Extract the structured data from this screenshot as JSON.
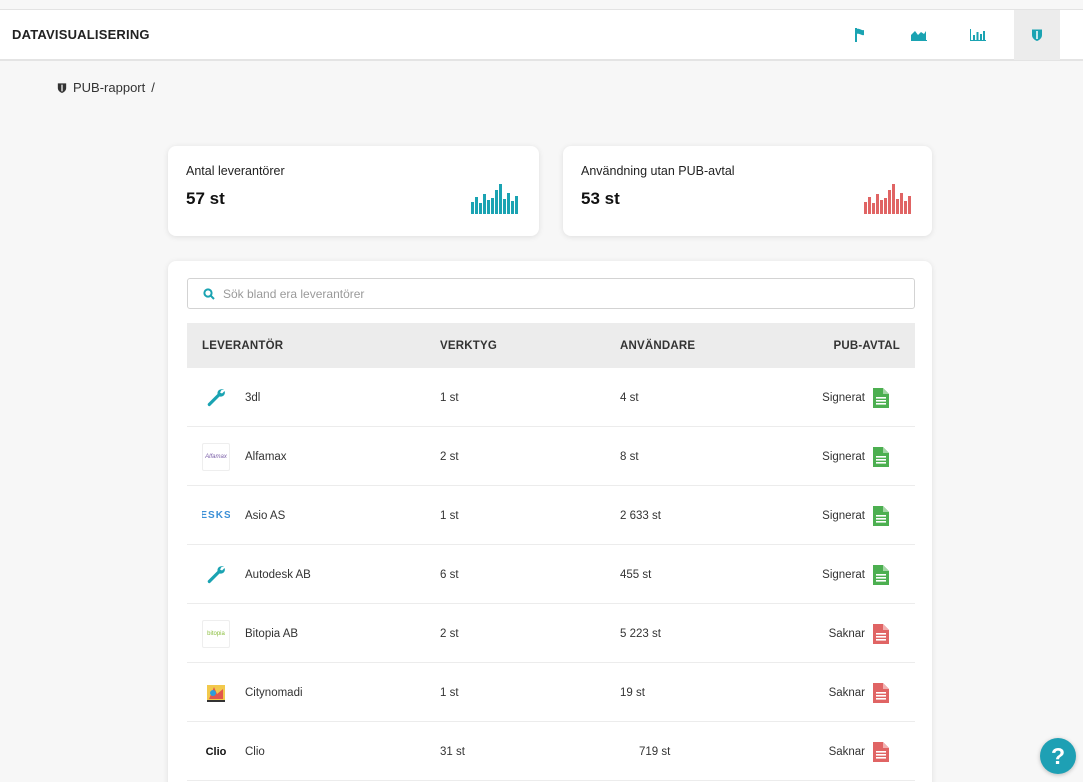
{
  "header": {
    "title": "DATAVISUALISERING",
    "nav": [
      {
        "icon": "flag-icon",
        "active": false
      },
      {
        "icon": "area-chart-icon",
        "active": false
      },
      {
        "icon": "bar-chart-icon",
        "active": false
      },
      {
        "icon": "shield-icon",
        "active": true
      }
    ]
  },
  "breadcrumb": {
    "label": "PUB-rapport",
    "separator": "/"
  },
  "stats": [
    {
      "label": "Antal leverantörer",
      "value": "57 st",
      "color": "#1aa3b2"
    },
    {
      "label": "Användning utan PUB-avtal",
      "value": "53 st",
      "color": "#e06464"
    }
  ],
  "search": {
    "placeholder": "Sök bland era leverantörer",
    "value": ""
  },
  "table": {
    "columns": [
      "LEVERANTÖR",
      "VERKTYG",
      "ANVÄNDARE",
      "PUB-AVTAL"
    ],
    "rows": [
      {
        "name": "3dl",
        "logo": "wrench-icon",
        "tools": "1 st",
        "users": "4 st",
        "status": "Signerat",
        "signed": true
      },
      {
        "name": "Alfamax",
        "logo": "alfamax-logo",
        "logo_text": "Alfamax",
        "tools": "2 st",
        "users": "8 st",
        "status": "Signerat",
        "signed": true
      },
      {
        "name": "Asio AS",
        "logo": "asio-logo",
        "logo_text": "ESKS",
        "tools": "1 st",
        "users": "2 633 st",
        "status": "Signerat",
        "signed": true
      },
      {
        "name": "Autodesk AB",
        "logo": "wrench-icon",
        "tools": "6 st",
        "users": "455 st",
        "status": "Signerat",
        "signed": true
      },
      {
        "name": "Bitopia AB",
        "logo": "bitopia-logo",
        "logo_text": "bitopia",
        "tools": "2 st",
        "users": "5 223 st",
        "status": "Saknar",
        "signed": false
      },
      {
        "name": "Citynomadi",
        "logo": "citynomadi-logo",
        "tools": "1 st",
        "users": "19 st",
        "status": "Saknar",
        "signed": false
      },
      {
        "name": "Clio",
        "logo": "clio-logo",
        "logo_text": "Clio",
        "tools": "31 st",
        "users": "719 st",
        "status": "Saknar",
        "signed": false
      }
    ]
  },
  "colors": {
    "accent": "#1aa3b2",
    "signed": "#4caf50",
    "missing": "#e06464",
    "help": "#1ea0b4"
  },
  "help": {
    "label": "?"
  }
}
